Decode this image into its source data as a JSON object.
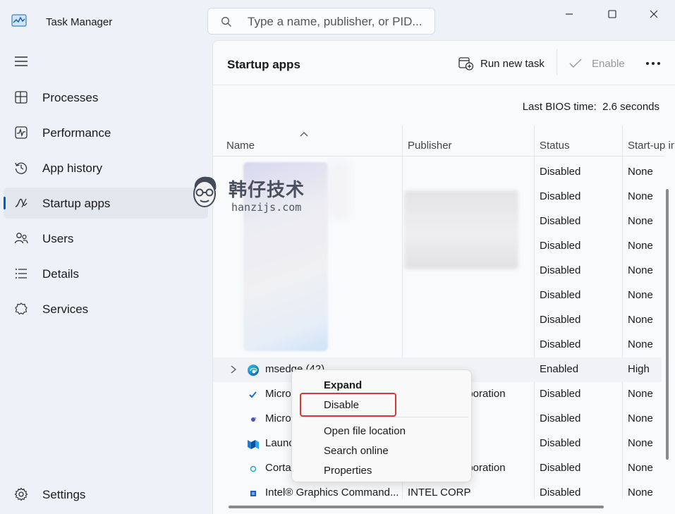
{
  "window": {
    "title": "Task Manager",
    "search_placeholder": "Type a name, publisher, or PID..."
  },
  "sidebar": {
    "items": [
      {
        "label": "Processes",
        "icon": "processes-icon"
      },
      {
        "label": "Performance",
        "icon": "performance-icon"
      },
      {
        "label": "App history",
        "icon": "history-icon"
      },
      {
        "label": "Startup apps",
        "icon": "startup-icon",
        "active": true
      },
      {
        "label": "Users",
        "icon": "users-icon"
      },
      {
        "label": "Details",
        "icon": "details-icon"
      },
      {
        "label": "Services",
        "icon": "services-icon"
      }
    ],
    "settings_label": "Settings"
  },
  "main": {
    "title": "Startup apps",
    "run_new_task": "Run new task",
    "enable": "Enable",
    "bios_label": "Last BIOS time:",
    "bios_value": "2.6 seconds",
    "columns": [
      "Name",
      "Publisher",
      "Status",
      "Start-up in"
    ],
    "rows": [
      {
        "name": "",
        "publisher": "",
        "status": "Disabled",
        "impact": "None"
      },
      {
        "name": "",
        "publisher": "",
        "status": "Disabled",
        "impact": "None"
      },
      {
        "name": "",
        "publisher": "",
        "status": "Disabled",
        "impact": "None"
      },
      {
        "name": "",
        "publisher": "",
        "status": "Disabled",
        "impact": "None"
      },
      {
        "name": "",
        "publisher": "",
        "status": "Disabled",
        "impact": "None"
      },
      {
        "name": "",
        "publisher": "",
        "status": "Disabled",
        "impact": "None"
      },
      {
        "name": "",
        "publisher": "",
        "status": "Disabled",
        "impact": "None"
      },
      {
        "name": "",
        "publisher": "",
        "status": "Disabled",
        "impact": "None"
      },
      {
        "name": "msedge (42)",
        "publisher": "",
        "status": "Enabled",
        "impact": "High"
      },
      {
        "name": "Micro",
        "publisher": "oporation",
        "status": "Disabled",
        "impact": "None"
      },
      {
        "name": "Micro",
        "publisher": "",
        "status": "Disabled",
        "impact": "None"
      },
      {
        "name": "Launc",
        "publisher": "",
        "status": "Disabled",
        "impact": "None"
      },
      {
        "name": "Cortar",
        "publisher": "oporation",
        "status": "Disabled",
        "impact": "None"
      },
      {
        "name": "Intel® Graphics Command...",
        "publisher": "INTEL CORP",
        "status": "Disabled",
        "impact": "None"
      }
    ]
  },
  "context_menu": {
    "expand": "Expand",
    "disable": "Disable",
    "open_file_location": "Open file location",
    "search_online": "Search online",
    "properties": "Properties"
  },
  "watermark": {
    "cn": "韩仔技术",
    "en": "hanzijs.com"
  },
  "colors": {
    "accent": "#005fb8",
    "highlight_box": "#d9383a"
  }
}
